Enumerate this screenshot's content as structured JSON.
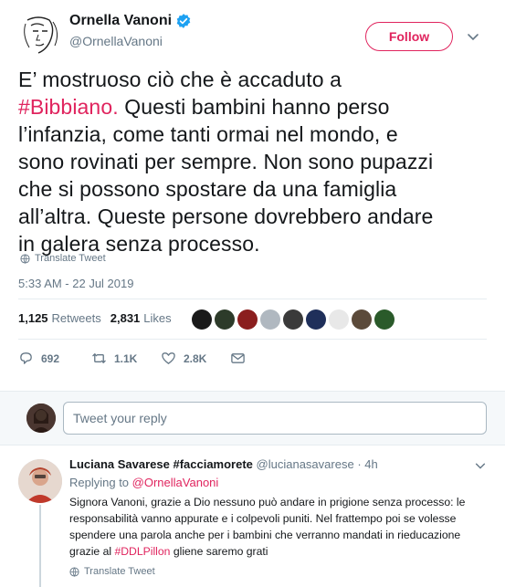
{
  "tweet": {
    "display_name": "Ornella Vanoni",
    "handle": "@OrnellaVanoni",
    "follow_label": "Follow",
    "text_lines": [
      "E’ mostruoso ciò che è accaduto a",
      "Questi bambini hanno perso",
      "l’infanzia, come tanti ormai nel mondo, e",
      "sono rovinati per sempre. Non sono pupazzi",
      "che si possono spostare da una famiglia",
      "all’altra. Queste persone dovrebbero andare",
      "in galera senza processo."
    ],
    "hashtag": "#Bibbiano.",
    "translate_label": "Translate Tweet",
    "timestamp": "5:33 AM - 22 Jul 2019",
    "retweets_count": "1,125",
    "retweets_label": "Retweets",
    "likes_count": "2,831",
    "likes_label": "Likes",
    "reply_count": "692",
    "retweet_action_count": "1.1K",
    "like_action_count": "2.8K",
    "liker_colors": [
      "#1a1a1a",
      "#2d3b2a",
      "#8b1e1e",
      "#b0b8c0",
      "#3a3a3a",
      "#1f2f5a",
      "#e8e8e8",
      "#5b4a3a",
      "#2a5a2a"
    ]
  },
  "reply_box": {
    "placeholder": "Tweet your reply"
  },
  "reply": {
    "display_name": "Luciana Savarese #facciamorete",
    "handle": "@lucianasavarese",
    "separator": "·",
    "time": "4h",
    "replying_prefix": "Replying to",
    "replying_to": "@OrnellaVanoni",
    "text_lines": [
      "Signora Vanoni, grazie a Dio nessuno può andare in prigione senza processo: le",
      "responsabilità vanno appurate e i colpevoli puniti. Nel frattempo poi se volesse",
      "spendere una parola anche per i bambini che verranno mandati in rieducazione"
    ],
    "last_line_prefix": "grazie al",
    "last_line_hashtag": "#DDLPillon",
    "last_line_suffix": "gliene saremo grati",
    "translate_label": "Translate Tweet"
  },
  "colors": {
    "accent": "#e0245e",
    "secondary_text": "#657786",
    "verified_blue": "#1da1f2"
  }
}
